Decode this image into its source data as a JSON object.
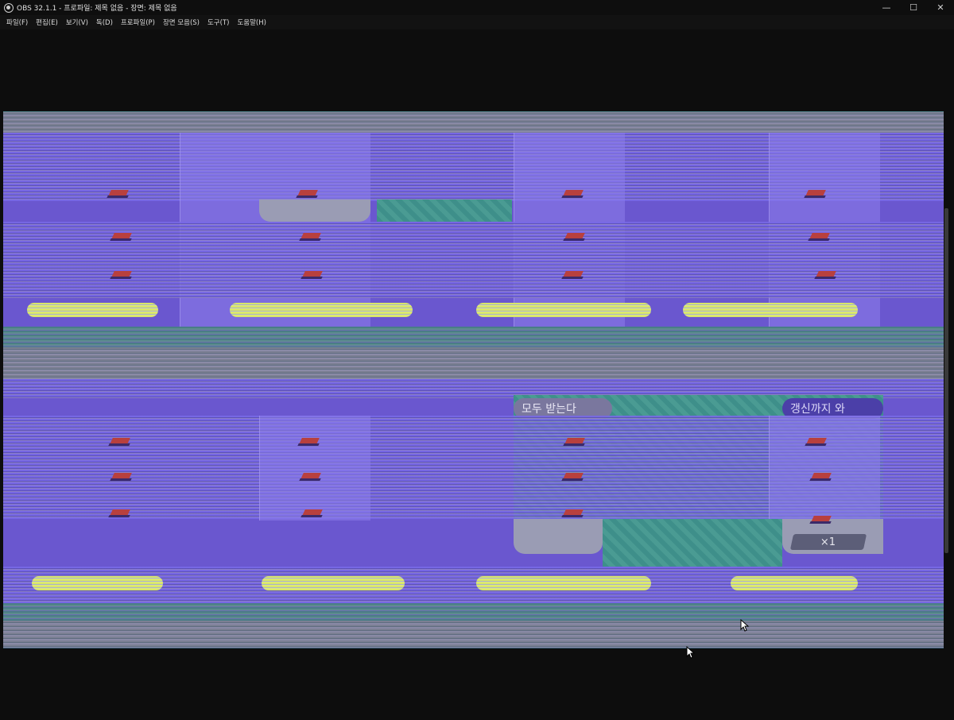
{
  "window": {
    "title": "OBS 32.1.1 - 프로파일: 제목 없음 - 장면: 제목 없음",
    "controls": {
      "minimize": "—",
      "maximize": "☐",
      "close": "✕"
    }
  },
  "menu": {
    "items": [
      {
        "label": "파일(F)"
      },
      {
        "label": "편집(E)"
      },
      {
        "label": "보기(V)"
      },
      {
        "label": "독(D)"
      },
      {
        "label": "프로파일(P)"
      },
      {
        "label": "장면 모음(S)"
      },
      {
        "label": "도구(T)"
      },
      {
        "label": "도움말(H)"
      }
    ]
  },
  "preview": {
    "visible_text": {
      "receive_all": "모두 받는다",
      "until_refresh": "갱신까지 와",
      "quantity": "×1"
    },
    "colors": {
      "glitch_purple": "#6a57cf",
      "glitch_yellow": "#d8e66a",
      "teal": "#4a7d86",
      "background": "#0d0d0d"
    }
  }
}
